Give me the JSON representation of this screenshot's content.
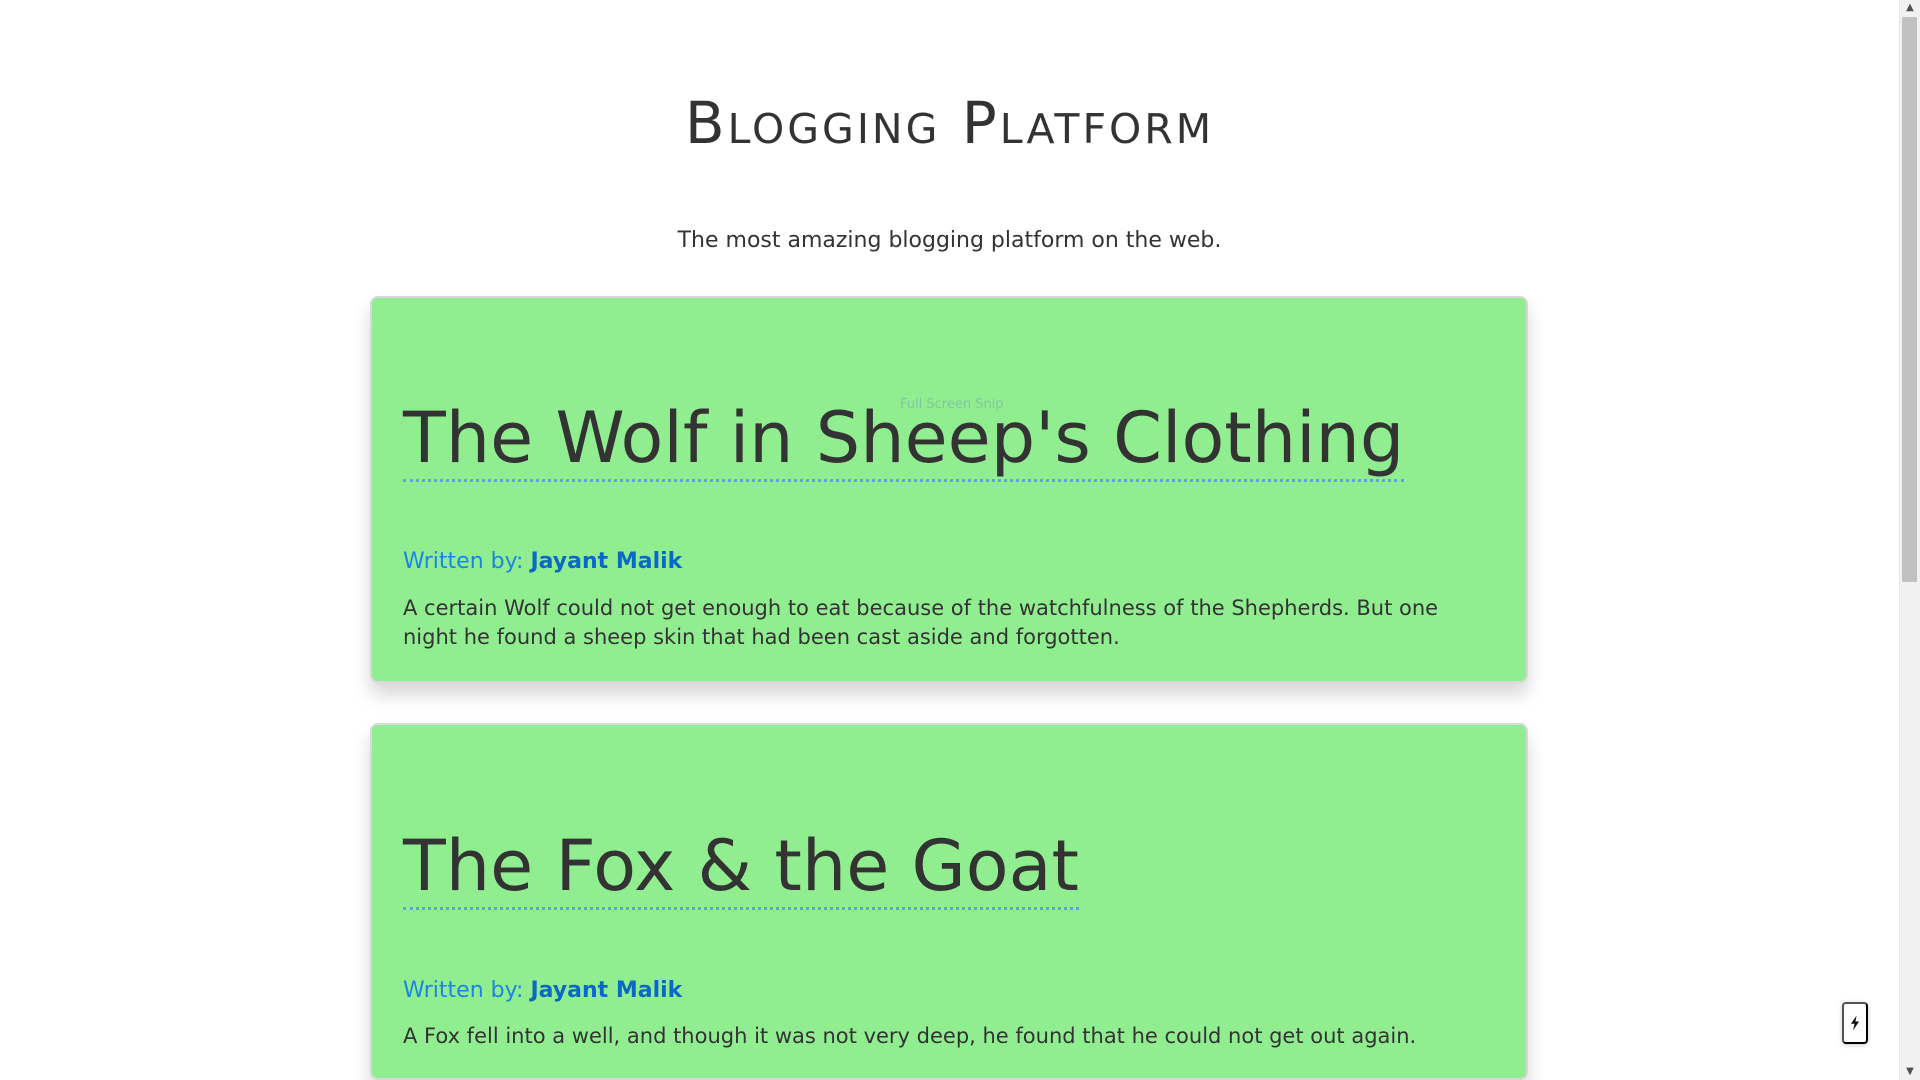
{
  "site": {
    "title": "Blogging Platform",
    "subtitle": "The most amazing blogging platform on the web."
  },
  "posts": [
    {
      "title": "The Wolf in Sheep's Clothing",
      "byline_prefix": "Written by:",
      "author": "Jayant Malik",
      "excerpt": "A certain Wolf could not get enough to eat because of the watchfulness of the Shepherds. But one night he found a sheep skin that had been cast aside and forgotten."
    },
    {
      "title": "The Fox & the Goat",
      "byline_prefix": "Written by:",
      "author": "Jayant Malik",
      "excerpt": "A Fox fell into a well, and though it was not very deep, he found that he could not get out again."
    }
  ],
  "overlay": {
    "snip_text": "Full Screen Snip"
  },
  "icons": {
    "quick_action": "lightning-bolt-icon",
    "scroll_up": "chevron-up-icon",
    "scroll_down": "chevron-down-icon"
  },
  "colors": {
    "card_background": "#90ee90",
    "heading_text": "#333333",
    "byline_text": "#1b84e6",
    "author_link": "#0b68c5",
    "title_underline": "#5aa7d6"
  }
}
